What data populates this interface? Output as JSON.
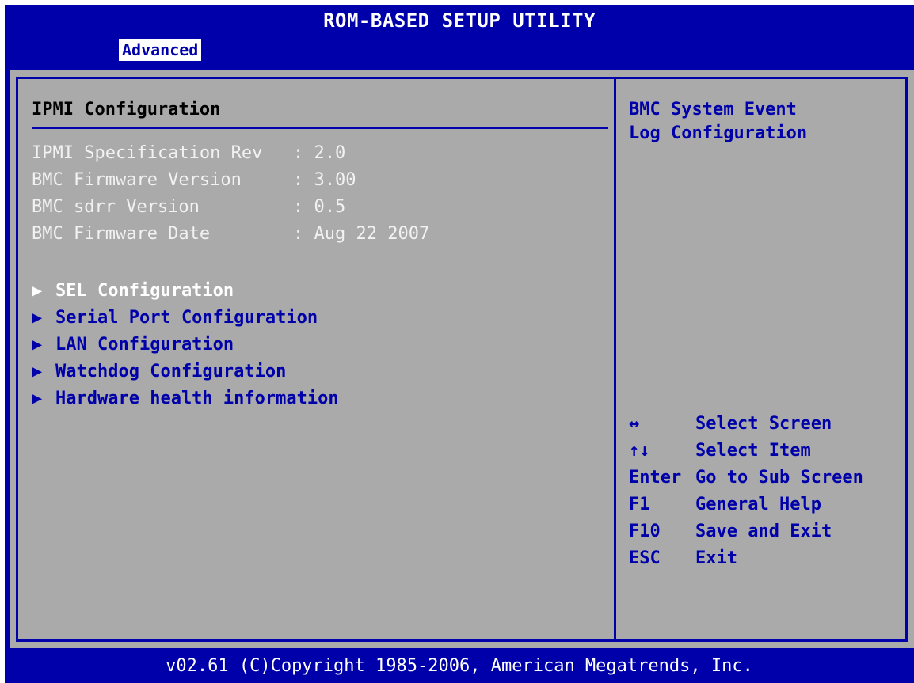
{
  "header": {
    "title": "ROM-BASED SETUP UTILITY",
    "active_tab": "Advanced"
  },
  "main": {
    "section_title": "IPMI Configuration",
    "info": [
      {
        "label": "IPMI Specification Rev",
        "value": ": 2.0"
      },
      {
        "label": "BMC Firmware Version",
        "value": ": 3.00"
      },
      {
        "label": "BMC sdrr Version",
        "value": ": 0.5"
      },
      {
        "label": "BMC Firmware Date",
        "value": ": Aug 22 2007"
      }
    ],
    "menu": [
      {
        "label": "SEL Configuration",
        "arrow": "▶",
        "selected": true
      },
      {
        "label": "Serial Port Configuration",
        "arrow": "▶",
        "selected": false
      },
      {
        "label": "LAN Configuration",
        "arrow": "▶",
        "selected": false
      },
      {
        "label": "Watchdog Configuration",
        "arrow": "▶",
        "selected": false
      },
      {
        "label": "Hardware health information",
        "arrow": "▶",
        "selected": false
      }
    ]
  },
  "help": {
    "line1": "BMC System Event",
    "line2": "Log Configuration"
  },
  "keys": [
    {
      "key": "↔",
      "action": "Select Screen"
    },
    {
      "key": "↑↓",
      "action": "Select Item"
    },
    {
      "key": "Enter",
      "action": "Go to Sub Screen"
    },
    {
      "key": "F1",
      "action": "General Help"
    },
    {
      "key": "F10",
      "action": "Save and Exit"
    },
    {
      "key": "ESC",
      "action": "Exit"
    }
  ],
  "footer": {
    "text": "v02.61 (C)Copyright 1985-2006, American Megatrends, Inc."
  },
  "colors": {
    "bios_blue": "#0000aa",
    "panel_gray": "#aaaaaa",
    "dim_text": "#f2f2f2"
  }
}
